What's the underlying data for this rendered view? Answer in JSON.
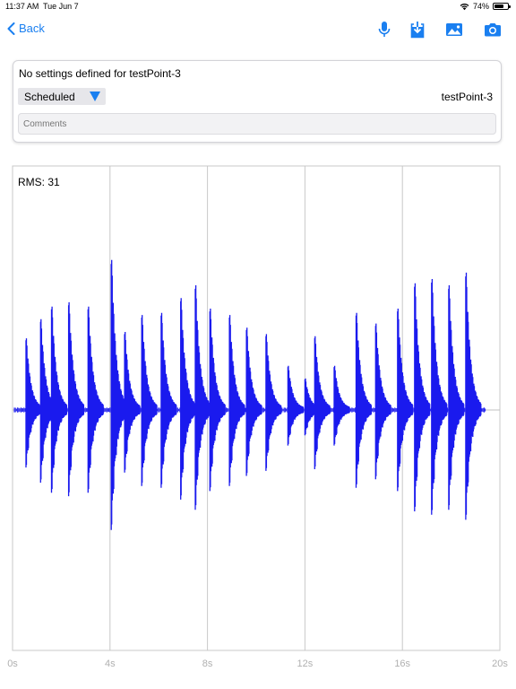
{
  "status": {
    "time": "11:37 AM",
    "date": "Tue Jun 7",
    "battery_text": "74%",
    "battery_level": 0.74
  },
  "nav": {
    "back_label": "Back",
    "icons": [
      "microphone-icon",
      "download-icon",
      "photo-icon",
      "camera-icon"
    ],
    "accent": "#1a7ff0"
  },
  "settings": {
    "message": "No settings defined for testPoint-3",
    "mode": "Scheduled",
    "point_name": "testPoint-3",
    "comments_placeholder": "Comments"
  },
  "chart_data": {
    "type": "line",
    "title": "",
    "xlabel": "",
    "ylabel": "",
    "rms_label": "RMS: 31",
    "x_ticks": [
      "0s",
      "4s",
      "8s",
      "12s",
      "16s",
      "20s"
    ],
    "xlim": [
      0,
      20
    ],
    "series_color": "#1a1aee",
    "grid": true,
    "series": [
      {
        "values_description": "",
        "x": [
          0.55,
          1.15,
          1.6,
          2.3,
          3.1,
          4.05,
          4.6,
          5.3,
          6.1,
          6.9,
          7.5,
          8.1,
          8.9,
          9.6,
          10.4,
          11.3,
          12.0,
          12.4,
          13.2,
          14.1,
          14.9,
          15.8,
          16.5,
          17.2,
          17.9,
          18.6
        ],
        "peaks": [
          0.33,
          0.42,
          0.48,
          0.5,
          0.48,
          0.7,
          0.36,
          0.44,
          0.45,
          0.52,
          0.58,
          0.47,
          0.44,
          0.38,
          0.35,
          0.2,
          0.14,
          0.34,
          0.2,
          0.45,
          0.4,
          0.47,
          0.59,
          0.61,
          0.58,
          0.64
        ]
      }
    ]
  }
}
